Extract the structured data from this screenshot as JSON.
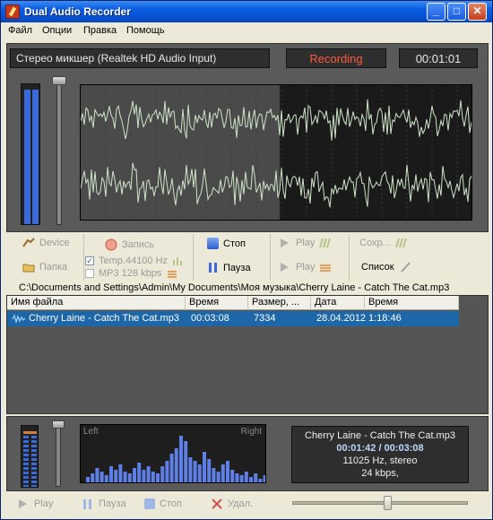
{
  "window": {
    "title": "Dual Audio Recorder"
  },
  "menu": [
    "Файл",
    "Опции",
    "Правка",
    "Помощь"
  ],
  "header": {
    "source": "Стерео микшер (Realtek HD Audio Input)",
    "status": "Recording",
    "timer": "00:01:01"
  },
  "controls": {
    "device": "Device",
    "folder": "Папка",
    "record": "Запись",
    "format1": "Temp.44100 Hz",
    "format2": "MP3 128 kbps",
    "stop": "Стоп",
    "pause": "Пауза",
    "play1": "Play",
    "play2": "Play",
    "save": "Сохр...",
    "list": "Список"
  },
  "path": "C:\\Documents and Settings\\Admin\\My Documents\\Моя музыка\\Cherry Laine - Catch The Cat.mp3",
  "file_list": {
    "columns": [
      "Имя файла",
      "Время",
      "Размер, ...",
      "Дата",
      "Время"
    ],
    "rows": [
      {
        "name": "Cherry Laine - Catch The Cat.mp3",
        "duration": "00:03:08",
        "size": "7334",
        "date": "28.04.2012",
        "time": "1:18:46"
      }
    ]
  },
  "player": {
    "spectrum_left": "Left",
    "spectrum_right": "Right",
    "track": "Cherry Laine - Catch The Cat.mp3",
    "position": "00:01:42 / 00:03:08",
    "format": "11025 Hz, stereo",
    "bitrate": "24 kbps,",
    "play": "Play",
    "pause": "Пауза",
    "stop": "Стоп",
    "delete": "Удал.",
    "seek_fraction": 0.54
  },
  "colors": {
    "status_red": "#ff5a3c",
    "selection_blue": "#1d67a8",
    "vu_blue": "#3a6ad9"
  }
}
